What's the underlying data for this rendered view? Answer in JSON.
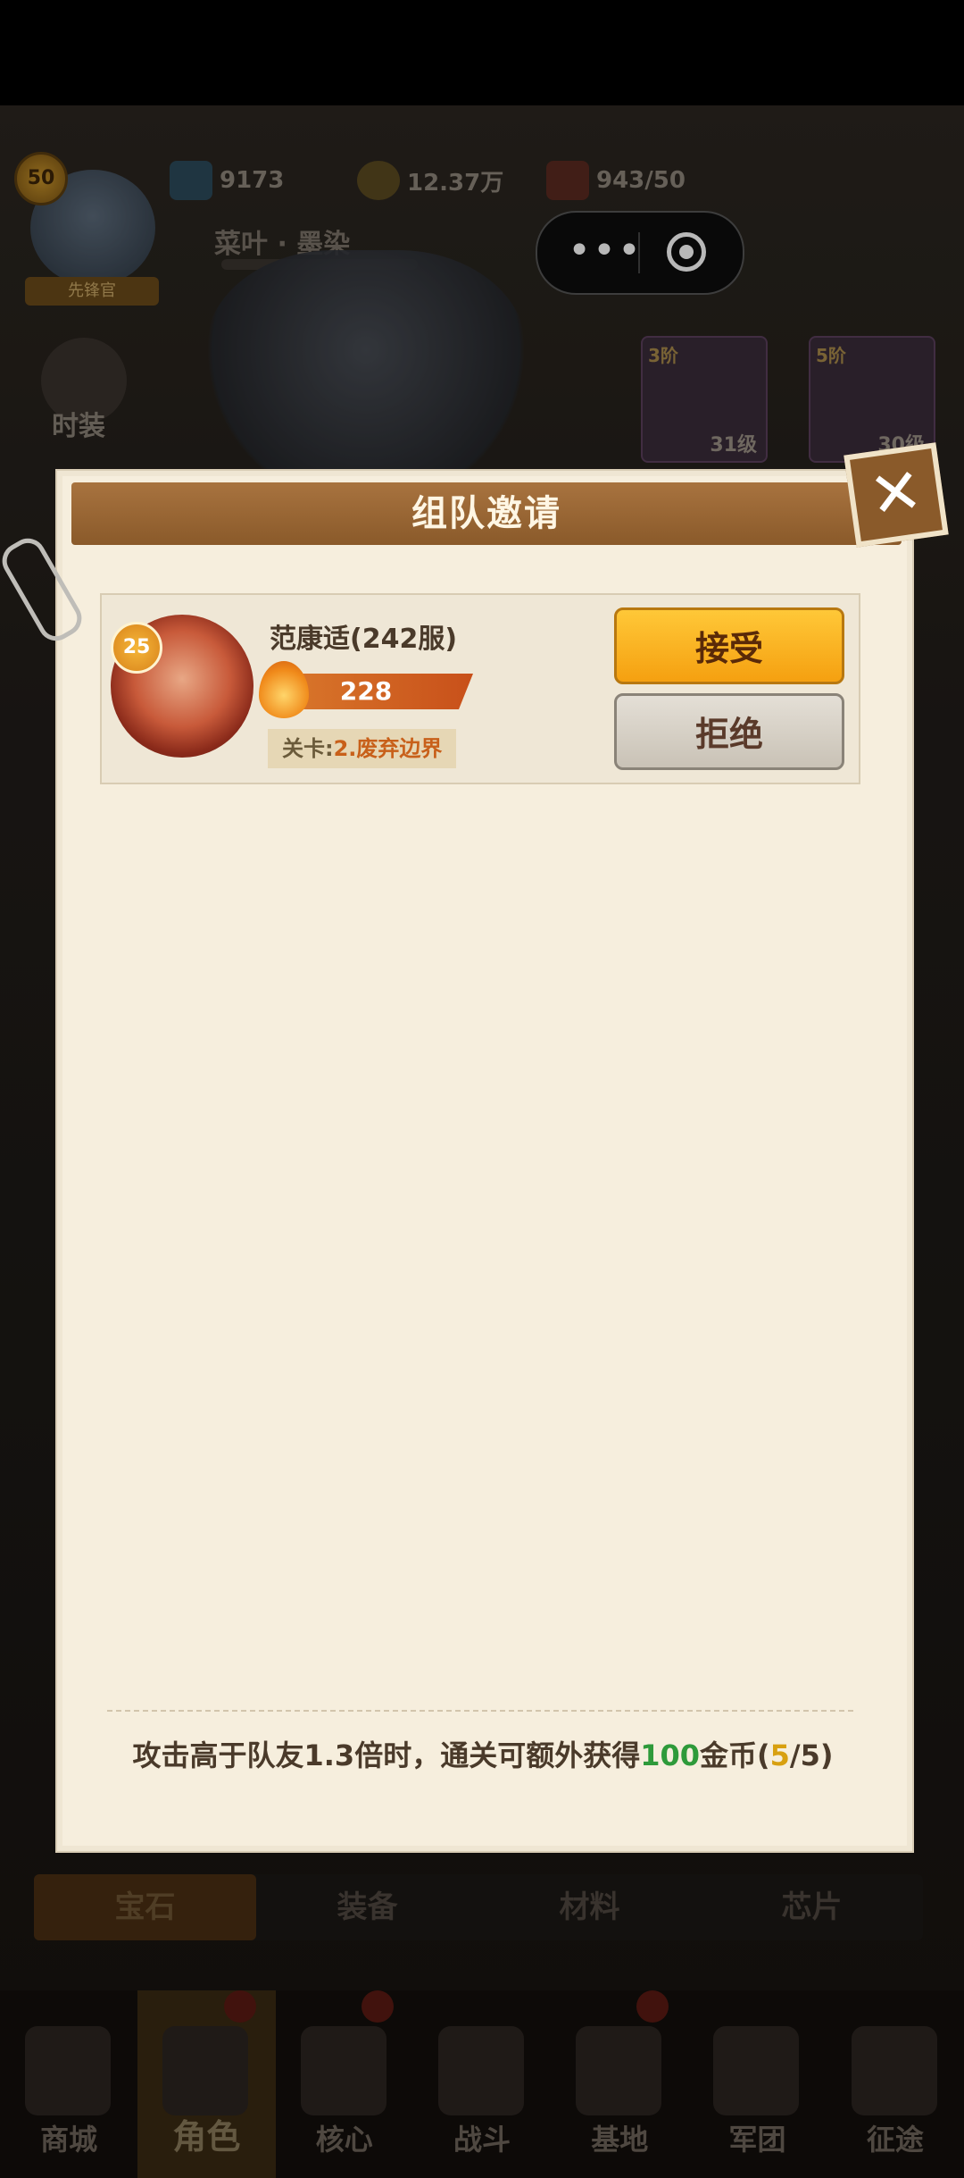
{
  "hud": {
    "level": "50",
    "rank_label": "先锋官",
    "player_name": "菜叶 · 墨染",
    "gems": "9173",
    "coins": "12.37万",
    "stamina": "943/50"
  },
  "side": {
    "fashion_label": "时装"
  },
  "equipment": [
    {
      "tier": "3阶",
      "level": "31级"
    },
    {
      "tier": "5阶",
      "level": "30级"
    }
  ],
  "modal": {
    "title": "组队邀请",
    "close": "✕",
    "invite": {
      "level": "25",
      "name": "范康适(242服)",
      "power": "228",
      "stage_prefix": "关卡:",
      "stage_value": "2.废弃边界",
      "accept_label": "接受",
      "reject_label": "拒绝"
    },
    "reward": {
      "text_before": "攻击高于队友1.3倍时，通关可额外获得",
      "amount": "100",
      "text_unit": "金币(",
      "count_current": "5",
      "count_sep": "/",
      "count_total": "5",
      "text_close": ")"
    }
  },
  "category_tabs": [
    "宝石",
    "装备",
    "材料",
    "芯片"
  ],
  "nav": [
    "商城",
    "角色",
    "核心",
    "战斗",
    "基地",
    "军团",
    "征途"
  ]
}
